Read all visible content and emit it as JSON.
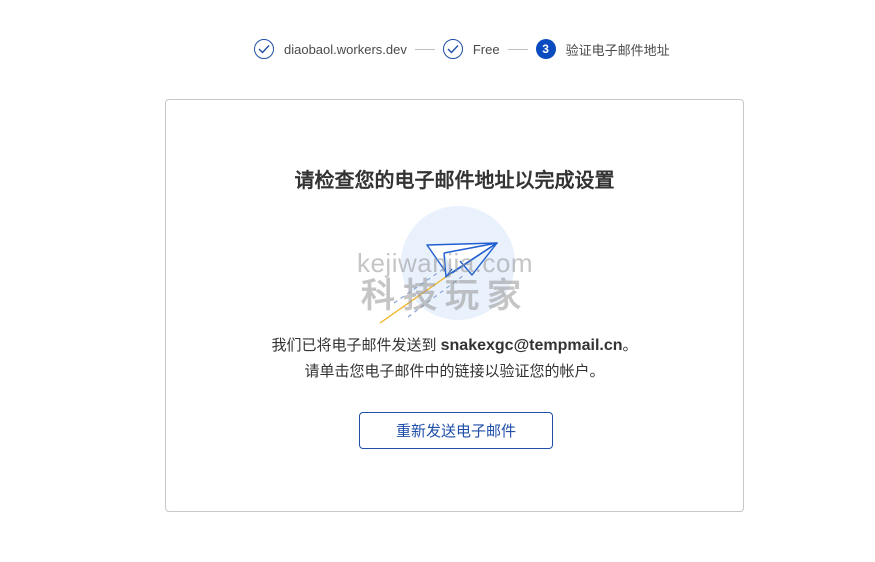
{
  "stepper": {
    "steps": [
      {
        "label": "diaobaol.workers.dev",
        "status": "done",
        "icon": "check-icon"
      },
      {
        "label": "Free",
        "status": "done",
        "icon": "check-icon"
      },
      {
        "label": "验证电子邮件地址",
        "status": "current",
        "number": "3"
      }
    ]
  },
  "card": {
    "title": "请检查您的电子邮件地址以完成设置",
    "message_prefix": "我们已将电子邮件发送到",
    "email": "snakexgc@tempmail.cn",
    "message_suffix": "。",
    "message_line2": "请单击您电子邮件中的链接以验证您的帐户。",
    "resend_label": "重新发送电子邮件",
    "illustration_icon": "paper-plane-icon"
  },
  "watermark": {
    "url": "kejiwanjia.com",
    "name": "科技玩家"
  },
  "colors": {
    "accent": "#1f4fa8",
    "current_step": "#0a4bbf",
    "border": "#c7c7c7"
  }
}
